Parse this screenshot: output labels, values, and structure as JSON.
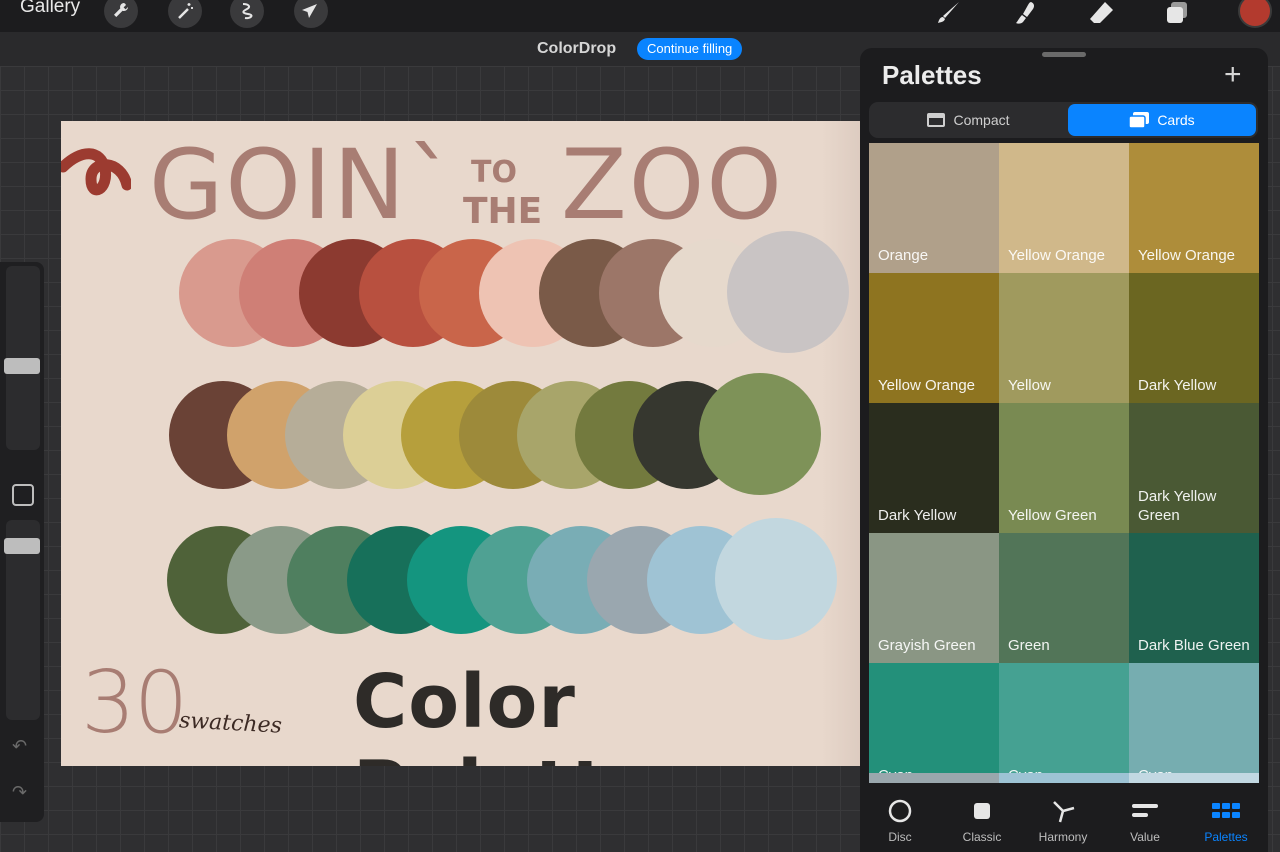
{
  "toolbar": {
    "gallery_label": "Gallery",
    "current_color": "#b33a2e",
    "left_icons": [
      "wrench-icon",
      "magic-wand-icon",
      "selection-icon",
      "transform-arrow-icon"
    ],
    "right_icons": [
      "brush-icon",
      "smudge-icon",
      "eraser-icon",
      "layers-icon"
    ]
  },
  "colordrop": {
    "label": "ColorDrop",
    "button_label": "Continue filling"
  },
  "artwork": {
    "title_goin": "GOIN`",
    "title_to": "TO",
    "title_the": "THE",
    "title_zoo": "ZOO",
    "count": "30",
    "count_label": "swatches",
    "subtitle": "Color Palette",
    "swatch_rows": [
      [
        "#d99a8e",
        "#cf7f76",
        "#8c3a30",
        "#b8503f",
        "#c9654a",
        "#eec3b3",
        "#7a5a48",
        "#9c7668",
        "#e6d9cc",
        "#c9c4c4"
      ],
      [
        "#6a4236",
        "#d0a26b",
        "#b6ad98",
        "#dccf96",
        "#b69f3c",
        "#9d8a3a",
        "#a8a56a",
        "#737a3e",
        "#36372f",
        "#7e9258"
      ],
      [
        "#4f6239",
        "#8a9a88",
        "#4f7f5f",
        "#17705a",
        "#14957f",
        "#4fa193",
        "#79adb5",
        "#9aa7af",
        "#9fc3d4",
        "#c2d7df"
      ]
    ]
  },
  "panel": {
    "title": "Palettes",
    "add_label": "+",
    "segments": [
      {
        "label": "Compact",
        "active": false
      },
      {
        "label": "Cards",
        "active": true
      }
    ],
    "cards": [
      {
        "name": "Orange",
        "color": "#b0a08a"
      },
      {
        "name": "Yellow Orange",
        "color": "#d0b88a"
      },
      {
        "name": "Yellow Orange",
        "color": "#ae8d3a"
      },
      {
        "name": "Yellow Orange",
        "color": "#8e7420"
      },
      {
        "name": "Yellow",
        "color": "#a09a5e"
      },
      {
        "name": "Dark Yellow",
        "color": "#6b6621"
      },
      {
        "name": "Dark Yellow",
        "color": "#2a2d1e"
      },
      {
        "name": "Yellow Green",
        "color": "#798a52"
      },
      {
        "name": "Dark Yellow Green",
        "color": "#4a5934"
      },
      {
        "name": "Grayish Green",
        "color": "#8a9684"
      },
      {
        "name": "Green",
        "color": "#527558"
      },
      {
        "name": "Dark Blue Green",
        "color": "#1f614e"
      },
      {
        "name": "Cyan",
        "color": "#23907a"
      },
      {
        "name": "Cyan",
        "color": "#45a192"
      },
      {
        "name": "Cyan",
        "color": "#76adb0"
      }
    ],
    "next_row_colors": [
      "#9aa7ad",
      "#9dc3d4",
      "#c2d8e2"
    ],
    "tabs": [
      {
        "label": "Disc",
        "icon": "disc-icon",
        "active": false
      },
      {
        "label": "Classic",
        "icon": "classic-square-icon",
        "active": false
      },
      {
        "label": "Harmony",
        "icon": "harmony-icon",
        "active": false
      },
      {
        "label": "Value",
        "icon": "value-sliders-icon",
        "active": false
      },
      {
        "label": "Palettes",
        "icon": "palettes-grid-icon",
        "active": true
      }
    ]
  }
}
